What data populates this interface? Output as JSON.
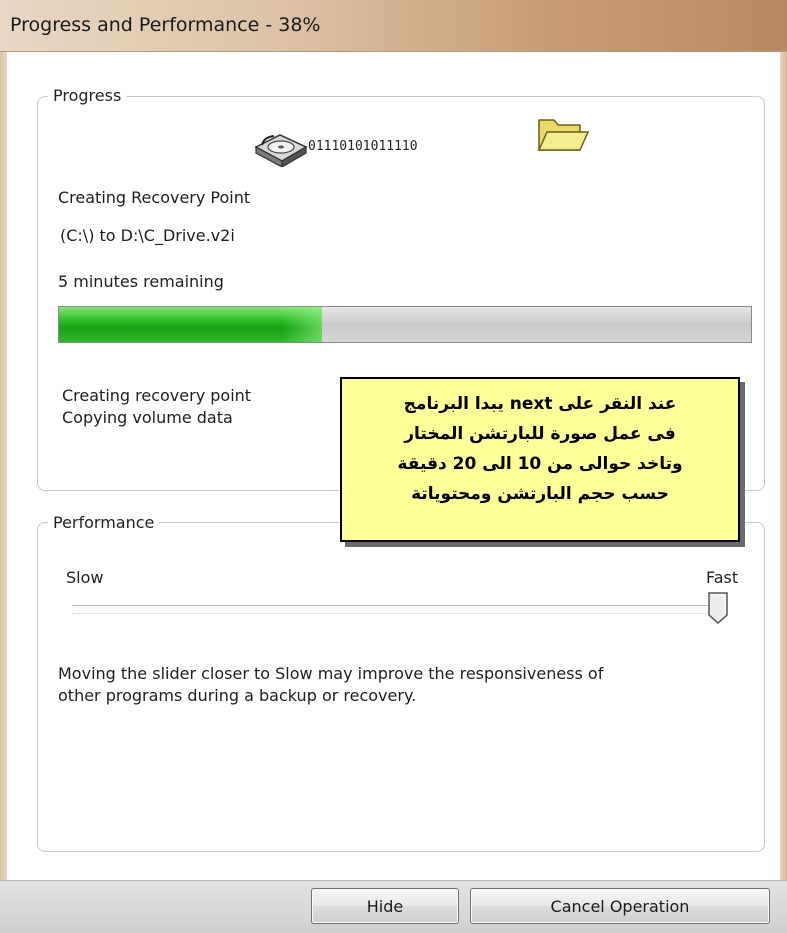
{
  "window": {
    "title": "Progress and Performance - 38%"
  },
  "progress": {
    "group_label": "Progress",
    "binary_text": "01110101011110",
    "task_title": "Creating Recovery Point",
    "task_detail": "(C:\\) to D:\\C_Drive.v2i",
    "time_remaining": "5 minutes remaining",
    "percent": 38,
    "status_line_1": "Creating recovery point",
    "status_line_2": "Copying volume data"
  },
  "callout": {
    "lines": [
      "عند النقر على  next  يبدا البرنامج",
      "فى عمل صورة للبارتشن المختار",
      "وتاخد حوالى من 10 الى 20 دقيقة",
      "حسب حجم البارتشن ومحتوياتة"
    ]
  },
  "performance": {
    "group_label": "Performance",
    "slow_label": "Slow",
    "fast_label": "Fast",
    "slider_value": 1.0,
    "description_line_1": "Moving the slider closer to Slow may improve the responsiveness of",
    "description_line_2": "other programs during a backup or recovery."
  },
  "buttons": {
    "hide": "Hide",
    "cancel": "Cancel Operation"
  },
  "colors": {
    "progress_fill": "#16a114",
    "callout_bg": "#ffff99"
  },
  "icons": {
    "disk": "hard-disk-icon",
    "folder": "open-folder-icon",
    "thumb": "slider-thumb"
  }
}
